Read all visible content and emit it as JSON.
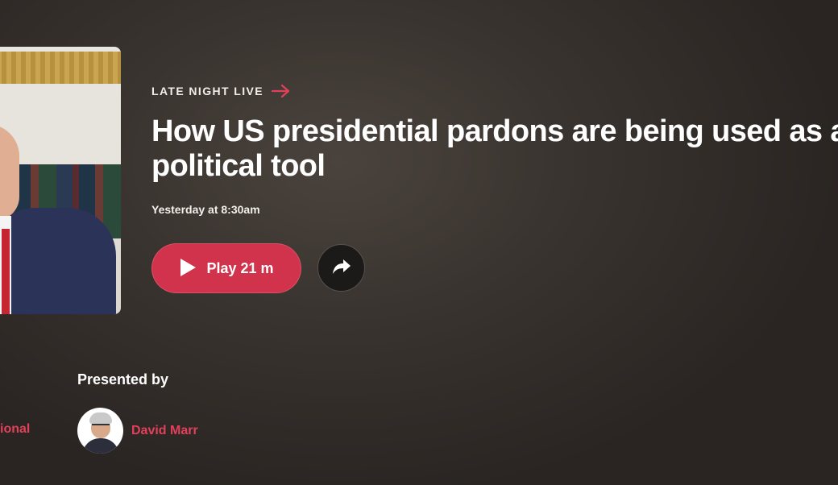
{
  "episode": {
    "program": "LATE NIGHT LIVE",
    "title": "How US presidential pardons are being used as a political tool",
    "broadcast_time": "Yesterday at 8:30am"
  },
  "actions": {
    "play_label": "Play 21 m",
    "share_icon": "share-arrow-icon"
  },
  "presenters": {
    "heading": "Presented by",
    "previous_partial": "ional",
    "items": [
      {
        "name": "David Marr",
        "avatar": "presenter-photo"
      }
    ]
  },
  "colors": {
    "accent": "#d2334c",
    "link": "#e2405a",
    "background": "#3a3430"
  }
}
